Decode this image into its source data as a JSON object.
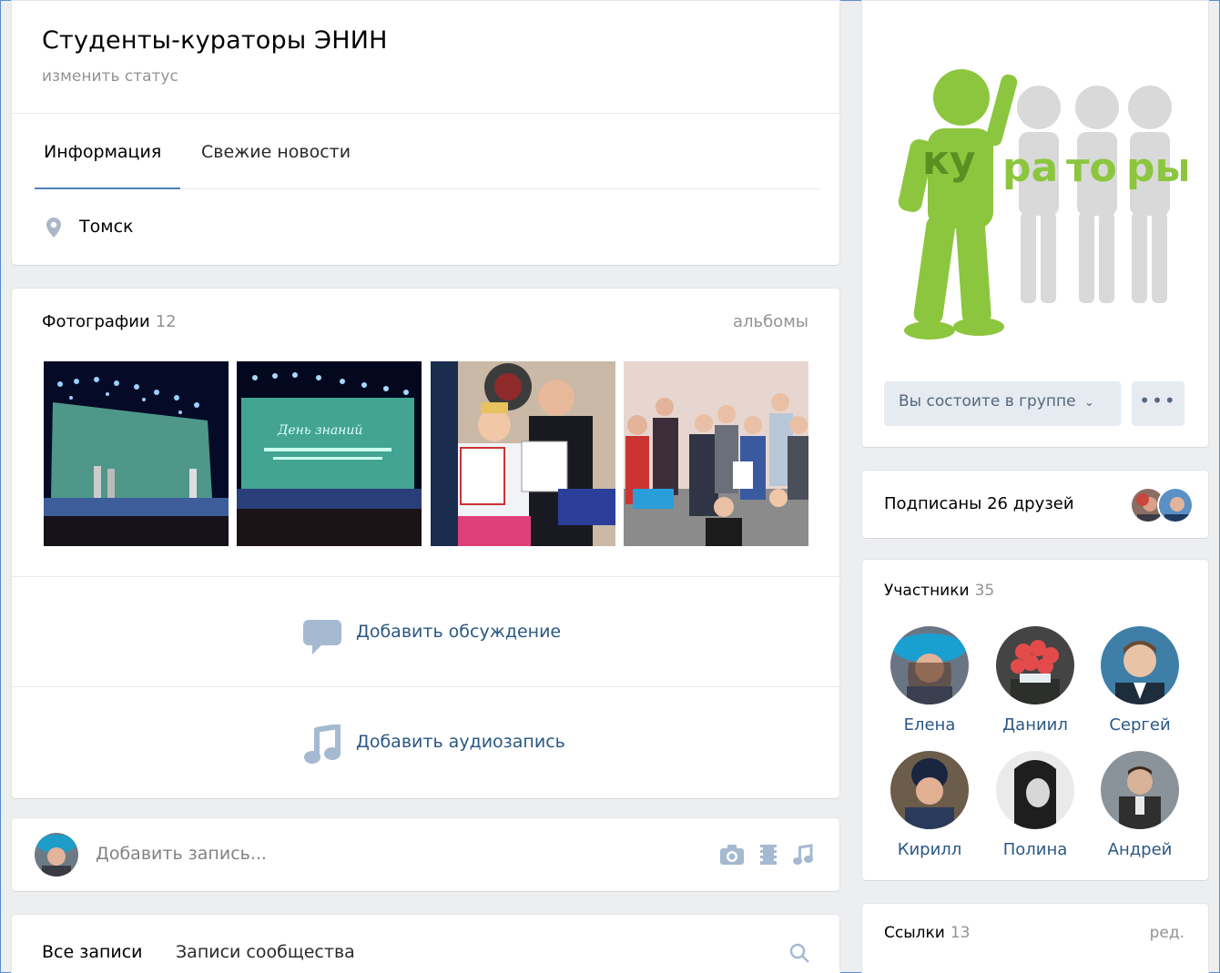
{
  "group": {
    "title": "Студенты-кураторы ЭНИН",
    "status": "изменить статус"
  },
  "tabs": [
    {
      "label": "Информация",
      "active": true
    },
    {
      "label": "Свежие новости",
      "active": false
    }
  ],
  "location": {
    "icon": "location-pin-icon",
    "text": "Томск"
  },
  "photos": {
    "title": "Фотографии",
    "count": "12",
    "albums_link": "альбомы"
  },
  "actions": {
    "add_discussion": "Добавить обсуждение",
    "add_audio": "Добавить аудиозапись"
  },
  "post": {
    "placeholder": "Добавить запись..."
  },
  "wall": {
    "all_posts": "Все записи",
    "community_posts": "Записи сообщества"
  },
  "cover": {
    "syllables": [
      "ку",
      "ра",
      "то",
      "ры"
    ]
  },
  "membership": {
    "button": "Вы состоите в группе",
    "more": "•••"
  },
  "friends": {
    "text": "Подписаны 26 друзей"
  },
  "members": {
    "title": "Участники",
    "count": "35",
    "people": [
      {
        "name": "Елена"
      },
      {
        "name": "Даниил"
      },
      {
        "name": "Сергей"
      },
      {
        "name": "Кирилл"
      },
      {
        "name": "Полина"
      },
      {
        "name": "Андрей"
      }
    ]
  },
  "links": {
    "title": "Ссылки",
    "count": "13",
    "edit": "ред."
  },
  "colors": {
    "accent": "#5181b8",
    "link": "#2a5885",
    "muted": "#939393",
    "cover_green": "#8cc63f"
  }
}
